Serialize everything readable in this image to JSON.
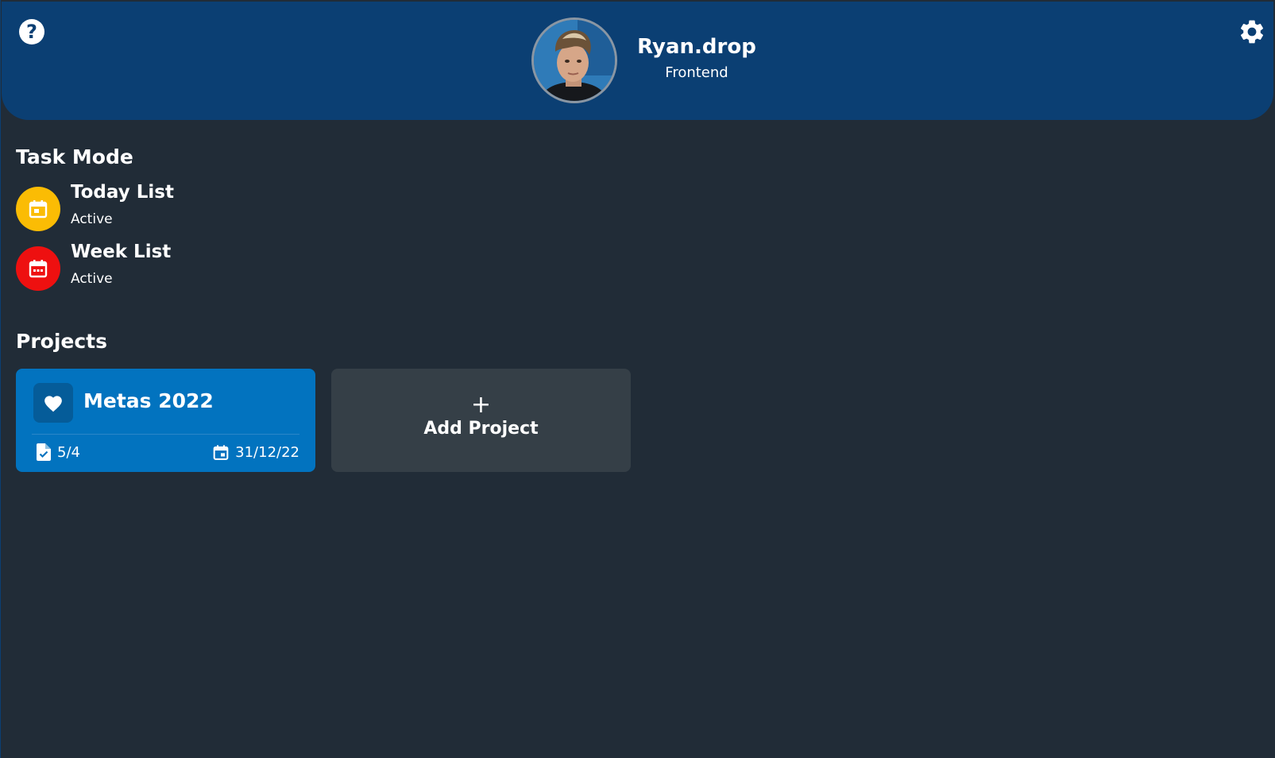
{
  "app": {
    "background": "#212c37",
    "header_color": "#0b3f73"
  },
  "header": {
    "help_icon": "question-icon",
    "settings_icon": "gear-icon",
    "user_name": "Ryan.drop",
    "user_role": "Frontend"
  },
  "task_mode": {
    "title": "Task Mode",
    "items": [
      {
        "label": "Today List",
        "status": "Active",
        "icon": "calendar-today-icon",
        "color": "#fbbc04"
      },
      {
        "label": "Week List",
        "status": "Active",
        "icon": "calendar-week-icon",
        "color": "#ee1010"
      }
    ]
  },
  "projects": {
    "title": "Projects",
    "items": [
      {
        "name": "Metas 2022",
        "icon": "heart-icon",
        "tasks": "5/4",
        "due_date": "31/12/22",
        "color": "#0273bf"
      }
    ],
    "add_label": "Add Project",
    "add_icon": "+"
  }
}
